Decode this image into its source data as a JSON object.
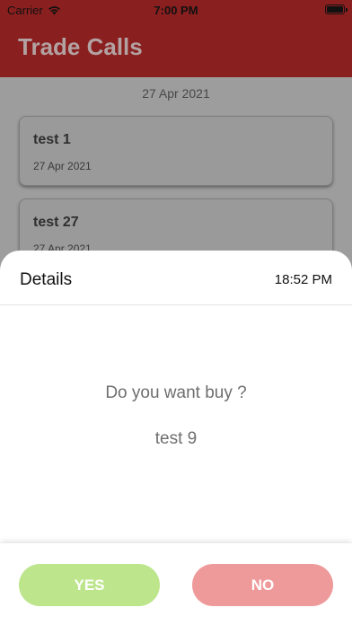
{
  "status_bar": {
    "carrier": "Carrier",
    "time": "7:00 PM",
    "icons": [
      "wifi-icon",
      "battery-icon"
    ]
  },
  "navbar": {
    "title": "Trade Calls"
  },
  "list": {
    "date_header": "27 Apr 2021",
    "items": [
      {
        "title": "test 1",
        "date": "27 Apr 2021"
      },
      {
        "title": "test 27",
        "date": "27 Apr 2021"
      }
    ]
  },
  "modal": {
    "title": "Details",
    "time": "18:52 PM",
    "question": "Do you want buy ?",
    "subject": "test 9",
    "yes_label": "YES",
    "no_label": "NO"
  },
  "colors": {
    "navbar": "#8a1f1f",
    "yes_button": "#bde58c",
    "no_button": "#ee9a9a"
  }
}
